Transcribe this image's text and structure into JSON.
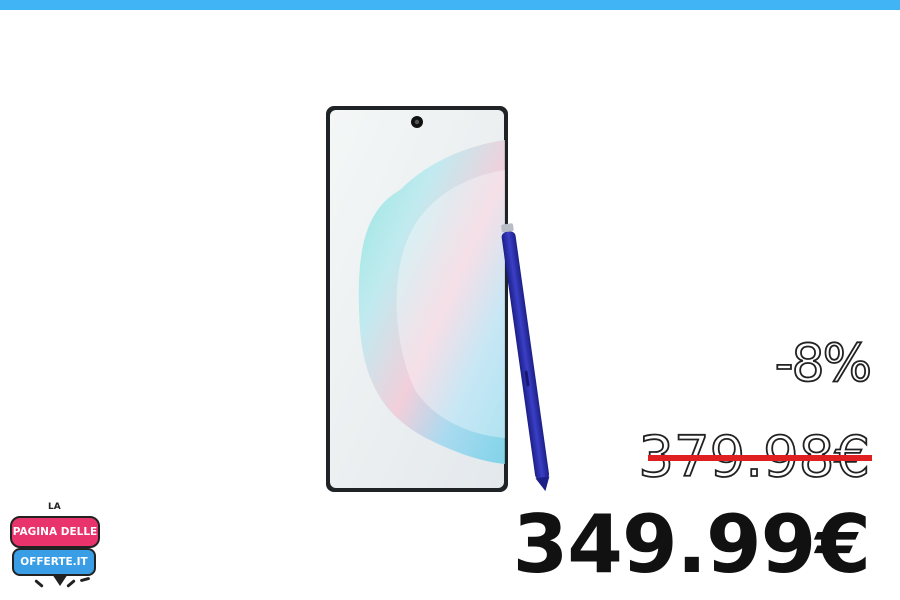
{
  "offer": {
    "discount": "-8%",
    "old_price": "379.98€",
    "new_price": "349.99€"
  },
  "logo": {
    "line_top": "LA",
    "line_1": "PAGINA DELLE",
    "line_2": "OFFERTE.IT"
  },
  "colors": {
    "top_bar": "#40b4f5",
    "strike": "#e02020",
    "logo_pink": "#e8336d",
    "logo_blue": "#3a9ee6",
    "pen_blue": "#2b2fa8"
  },
  "product": {
    "image": "phone-with-stylus-illustration"
  }
}
